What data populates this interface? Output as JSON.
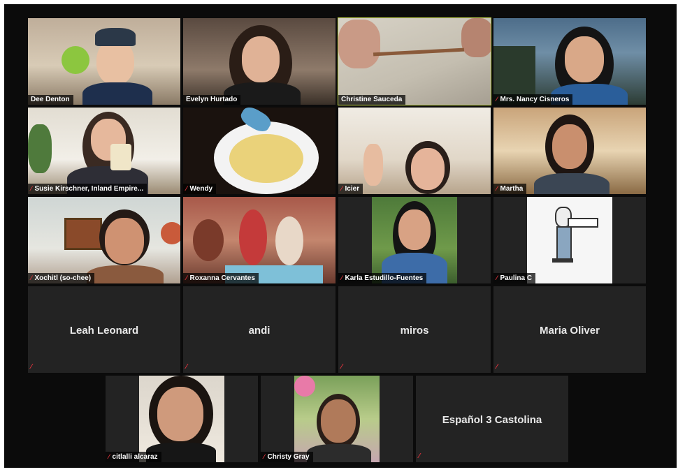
{
  "app": {
    "muted_icon": "mic-muted-icon",
    "active_speaker_color": "#c7d94a"
  },
  "participants": [
    {
      "name": "Dee Denton",
      "muted": false
    },
    {
      "name": "Evelyn Hurtado",
      "muted": false
    },
    {
      "name": "Christine Sauceda",
      "muted": false,
      "active_speaker": true
    },
    {
      "name": "Mrs. Nancy Cisneros",
      "muted": true
    },
    {
      "name": "Susie Kirschner, Inland Empire...",
      "muted": true
    },
    {
      "name": "Wendy",
      "muted": true
    },
    {
      "name": "Icier",
      "muted": true
    },
    {
      "name": "Martha",
      "muted": true
    },
    {
      "name": "Xochitl (so-chee)",
      "muted": true
    },
    {
      "name": "Roxanna Cervantes",
      "muted": true
    },
    {
      "name": "Karla Estudillo-Fuentes",
      "muted": true
    },
    {
      "name": "Paulina C",
      "muted": true
    },
    {
      "name": "Leah Leonard",
      "muted": true,
      "video_off": true
    },
    {
      "name": "andi",
      "muted": true,
      "video_off": true
    },
    {
      "name": "miros",
      "muted": true,
      "video_off": true
    },
    {
      "name": "Maria Oliver",
      "muted": true,
      "video_off": true
    },
    {
      "name": "citlalli alcaraz",
      "muted": true
    },
    {
      "name": "Christy Gray",
      "muted": true
    },
    {
      "name": "Español 3 Castolina",
      "muted": true,
      "video_off": true
    }
  ]
}
